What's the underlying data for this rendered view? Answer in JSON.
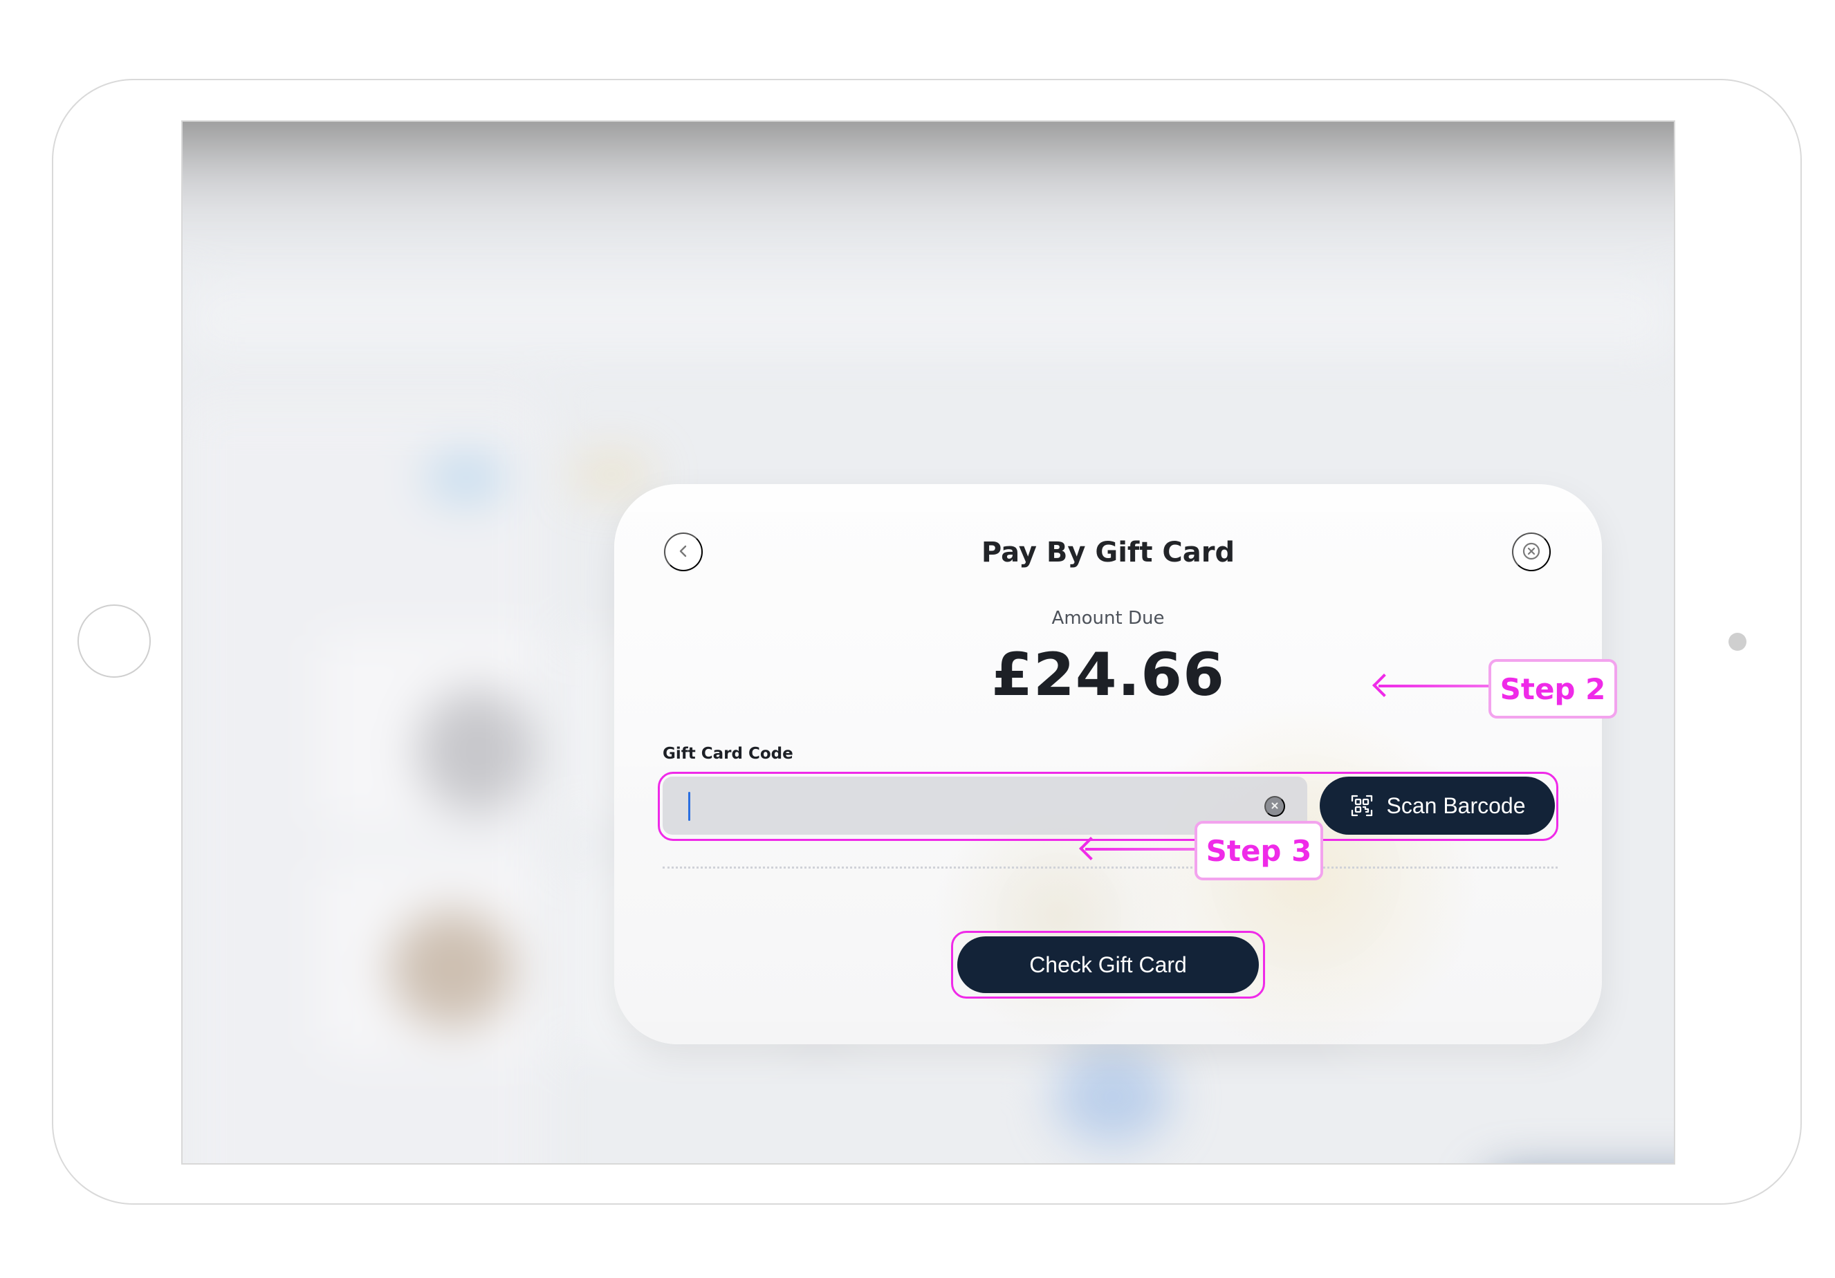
{
  "modal": {
    "title": "Pay By Gift Card",
    "amount_label": "Amount Due",
    "amount_value": "£24.66",
    "field_label": "Gift Card Code",
    "input": {
      "value": "",
      "placeholder": ""
    },
    "scan_button_label": "Scan Barcode",
    "check_button_label": "Check Gift Card",
    "icons": {
      "back": "chevron-left-icon",
      "close": "close-icon",
      "clear": "clear-icon",
      "scan": "barcode-scan-icon"
    }
  },
  "annotations": {
    "step2": "Step 2",
    "step3": "Step 3"
  },
  "colors": {
    "annotation": "#EF2AE8",
    "button_dark": "#132338",
    "input_bg": "#D7D8DD",
    "background": "#ECEEF1"
  }
}
